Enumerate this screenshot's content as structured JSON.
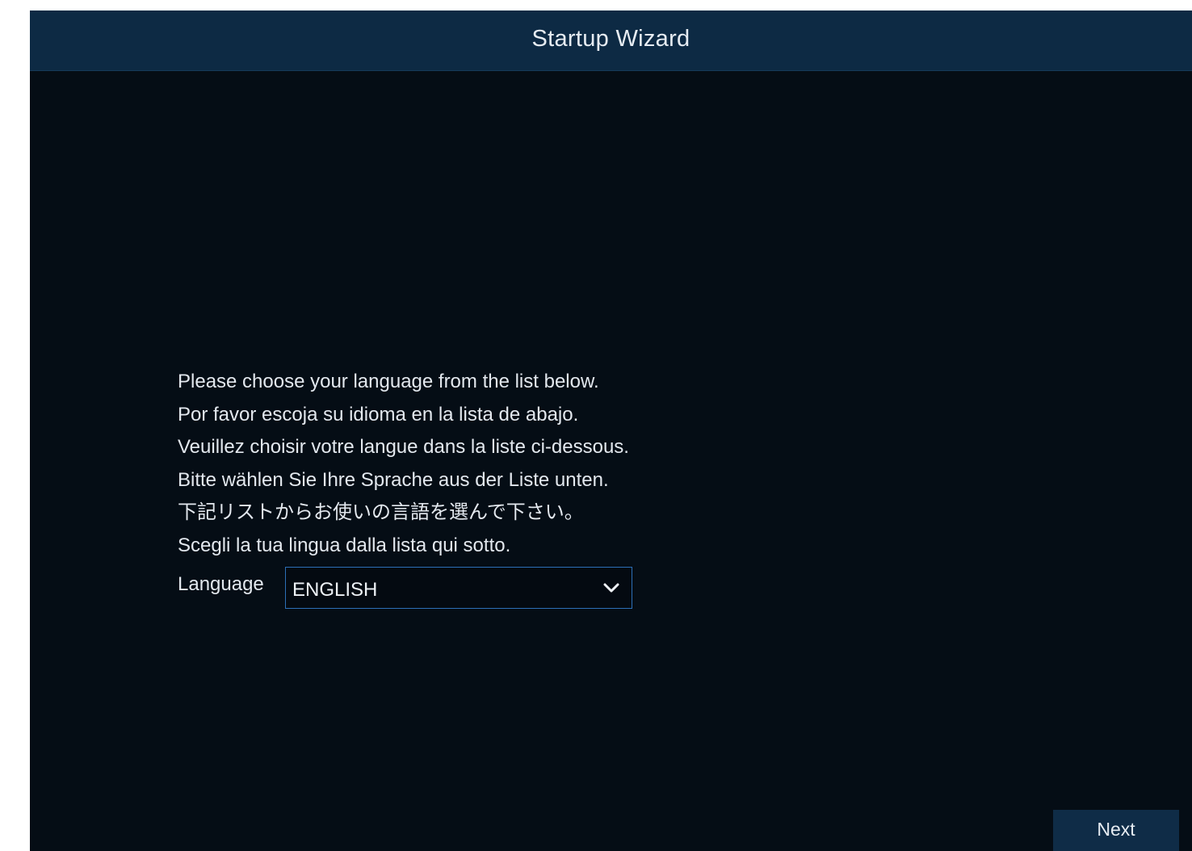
{
  "window": {
    "title": "Startup Wizard"
  },
  "instructions": [
    "Please choose your language from the list below.",
    "Por favor escoja su idioma en la lista de abajo.",
    "Veuillez choisir votre langue dans la liste ci-dessous.",
    "Bitte wählen Sie Ihre Sprache aus der Liste unten.",
    "下記リストからお使いの言語を選んで下さい。",
    "Scegli la tua lingua dalla lista qui sotto."
  ],
  "language": {
    "label": "Language",
    "selected": "ENGLISH",
    "icon": "chevron-down-icon"
  },
  "footer": {
    "next_label": "Next"
  },
  "colors": {
    "titlebar": "#0d2a44",
    "background": "#050d15",
    "select_border": "#2c6fb7",
    "button": "#0f2c47",
    "text": "#e3e8ee"
  }
}
